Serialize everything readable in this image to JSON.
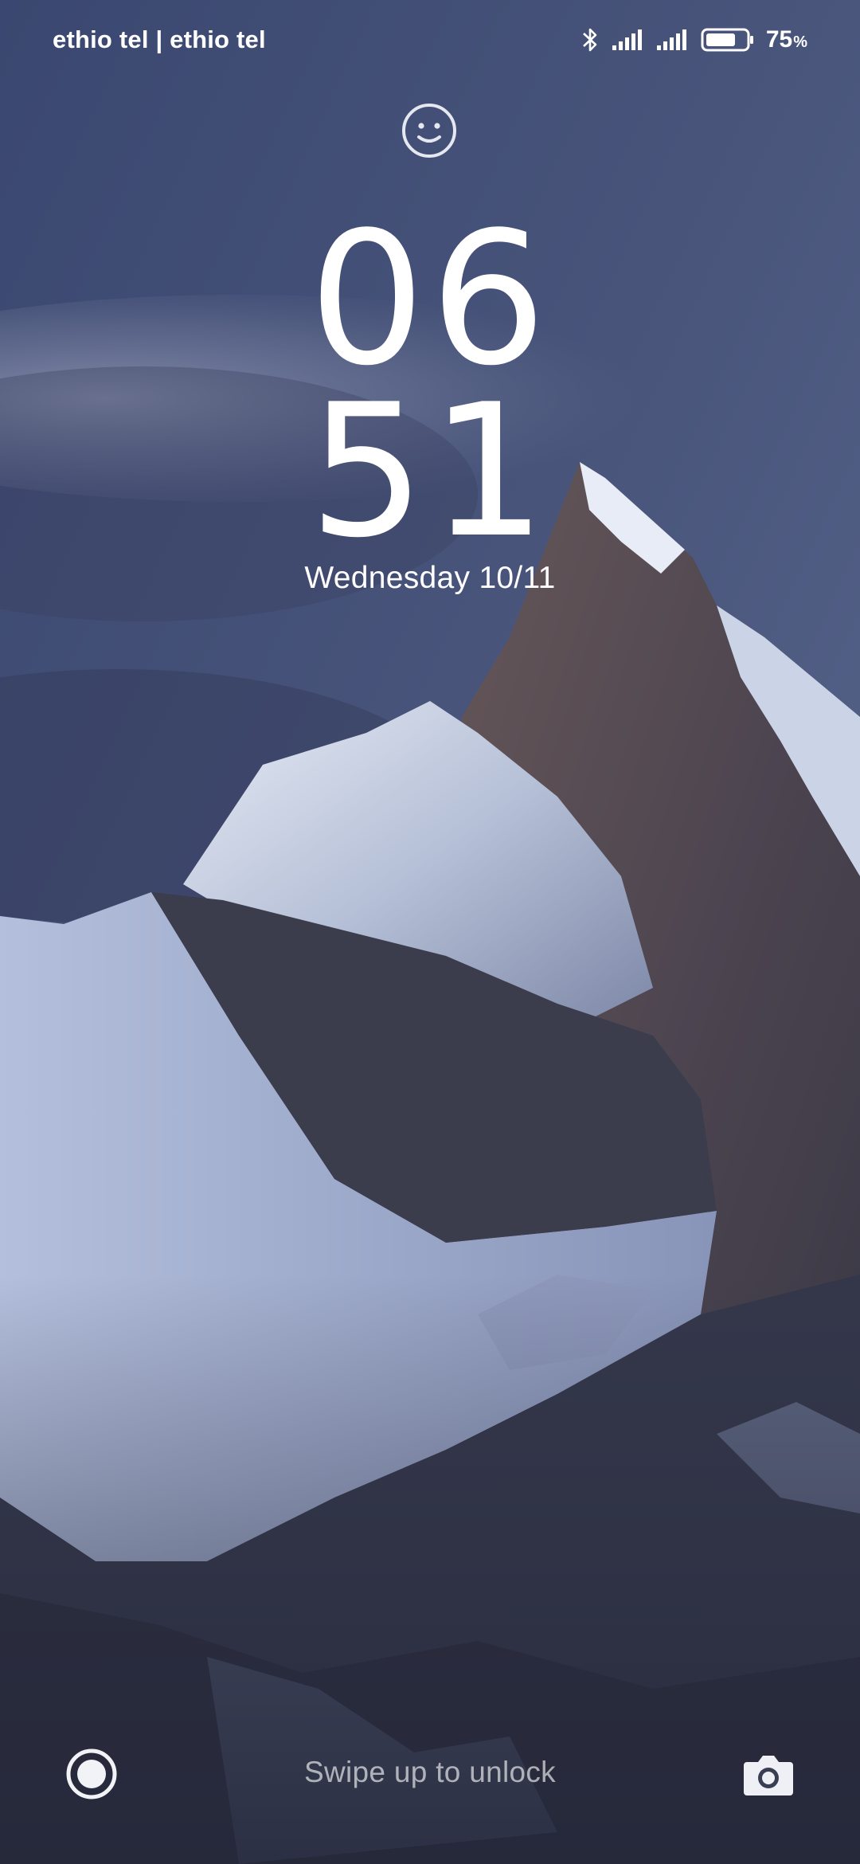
{
  "status_bar": {
    "carrier_text": "ethio tel | ethio tel",
    "icons": [
      "bluetooth-icon",
      "signal-icon",
      "signal-icon",
      "battery-icon"
    ],
    "battery_percent": "75",
    "battery_unit": "%",
    "battery_level": 0.75
  },
  "lock_screen": {
    "hours": "06",
    "minutes": "51",
    "date": "Wednesday 10/11",
    "unlock_hint": "Swipe up to unlock",
    "left_shortcut_icon": "record-icon",
    "right_shortcut_icon": "camera-icon",
    "top_icon": "smiley-face-icon"
  },
  "colors": {
    "sky_top": "#3c4a70",
    "sky_mid": "#4a5678",
    "snow": "#c8d0e4",
    "rock": "#3a3a44",
    "text": "#ffffff"
  }
}
